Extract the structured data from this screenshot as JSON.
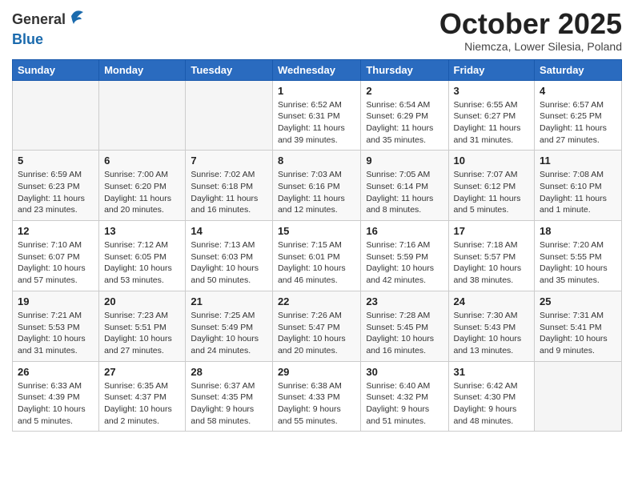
{
  "header": {
    "logo_general": "General",
    "logo_blue": "Blue",
    "month_title": "October 2025",
    "subtitle": "Niemcza, Lower Silesia, Poland"
  },
  "days_of_week": [
    "Sunday",
    "Monday",
    "Tuesday",
    "Wednesday",
    "Thursday",
    "Friday",
    "Saturday"
  ],
  "weeks": [
    [
      {
        "day": "",
        "info": ""
      },
      {
        "day": "",
        "info": ""
      },
      {
        "day": "",
        "info": ""
      },
      {
        "day": "1",
        "info": "Sunrise: 6:52 AM\nSunset: 6:31 PM\nDaylight: 11 hours\nand 39 minutes."
      },
      {
        "day": "2",
        "info": "Sunrise: 6:54 AM\nSunset: 6:29 PM\nDaylight: 11 hours\nand 35 minutes."
      },
      {
        "day": "3",
        "info": "Sunrise: 6:55 AM\nSunset: 6:27 PM\nDaylight: 11 hours\nand 31 minutes."
      },
      {
        "day": "4",
        "info": "Sunrise: 6:57 AM\nSunset: 6:25 PM\nDaylight: 11 hours\nand 27 minutes."
      }
    ],
    [
      {
        "day": "5",
        "info": "Sunrise: 6:59 AM\nSunset: 6:23 PM\nDaylight: 11 hours\nand 23 minutes."
      },
      {
        "day": "6",
        "info": "Sunrise: 7:00 AM\nSunset: 6:20 PM\nDaylight: 11 hours\nand 20 minutes."
      },
      {
        "day": "7",
        "info": "Sunrise: 7:02 AM\nSunset: 6:18 PM\nDaylight: 11 hours\nand 16 minutes."
      },
      {
        "day": "8",
        "info": "Sunrise: 7:03 AM\nSunset: 6:16 PM\nDaylight: 11 hours\nand 12 minutes."
      },
      {
        "day": "9",
        "info": "Sunrise: 7:05 AM\nSunset: 6:14 PM\nDaylight: 11 hours\nand 8 minutes."
      },
      {
        "day": "10",
        "info": "Sunrise: 7:07 AM\nSunset: 6:12 PM\nDaylight: 11 hours\nand 5 minutes."
      },
      {
        "day": "11",
        "info": "Sunrise: 7:08 AM\nSunset: 6:10 PM\nDaylight: 11 hours\nand 1 minute."
      }
    ],
    [
      {
        "day": "12",
        "info": "Sunrise: 7:10 AM\nSunset: 6:07 PM\nDaylight: 10 hours\nand 57 minutes."
      },
      {
        "day": "13",
        "info": "Sunrise: 7:12 AM\nSunset: 6:05 PM\nDaylight: 10 hours\nand 53 minutes."
      },
      {
        "day": "14",
        "info": "Sunrise: 7:13 AM\nSunset: 6:03 PM\nDaylight: 10 hours\nand 50 minutes."
      },
      {
        "day": "15",
        "info": "Sunrise: 7:15 AM\nSunset: 6:01 PM\nDaylight: 10 hours\nand 46 minutes."
      },
      {
        "day": "16",
        "info": "Sunrise: 7:16 AM\nSunset: 5:59 PM\nDaylight: 10 hours\nand 42 minutes."
      },
      {
        "day": "17",
        "info": "Sunrise: 7:18 AM\nSunset: 5:57 PM\nDaylight: 10 hours\nand 38 minutes."
      },
      {
        "day": "18",
        "info": "Sunrise: 7:20 AM\nSunset: 5:55 PM\nDaylight: 10 hours\nand 35 minutes."
      }
    ],
    [
      {
        "day": "19",
        "info": "Sunrise: 7:21 AM\nSunset: 5:53 PM\nDaylight: 10 hours\nand 31 minutes."
      },
      {
        "day": "20",
        "info": "Sunrise: 7:23 AM\nSunset: 5:51 PM\nDaylight: 10 hours\nand 27 minutes."
      },
      {
        "day": "21",
        "info": "Sunrise: 7:25 AM\nSunset: 5:49 PM\nDaylight: 10 hours\nand 24 minutes."
      },
      {
        "day": "22",
        "info": "Sunrise: 7:26 AM\nSunset: 5:47 PM\nDaylight: 10 hours\nand 20 minutes."
      },
      {
        "day": "23",
        "info": "Sunrise: 7:28 AM\nSunset: 5:45 PM\nDaylight: 10 hours\nand 16 minutes."
      },
      {
        "day": "24",
        "info": "Sunrise: 7:30 AM\nSunset: 5:43 PM\nDaylight: 10 hours\nand 13 minutes."
      },
      {
        "day": "25",
        "info": "Sunrise: 7:31 AM\nSunset: 5:41 PM\nDaylight: 10 hours\nand 9 minutes."
      }
    ],
    [
      {
        "day": "26",
        "info": "Sunrise: 6:33 AM\nSunset: 4:39 PM\nDaylight: 10 hours\nand 5 minutes."
      },
      {
        "day": "27",
        "info": "Sunrise: 6:35 AM\nSunset: 4:37 PM\nDaylight: 10 hours\nand 2 minutes."
      },
      {
        "day": "28",
        "info": "Sunrise: 6:37 AM\nSunset: 4:35 PM\nDaylight: 9 hours\nand 58 minutes."
      },
      {
        "day": "29",
        "info": "Sunrise: 6:38 AM\nSunset: 4:33 PM\nDaylight: 9 hours\nand 55 minutes."
      },
      {
        "day": "30",
        "info": "Sunrise: 6:40 AM\nSunset: 4:32 PM\nDaylight: 9 hours\nand 51 minutes."
      },
      {
        "day": "31",
        "info": "Sunrise: 6:42 AM\nSunset: 4:30 PM\nDaylight: 9 hours\nand 48 minutes."
      },
      {
        "day": "",
        "info": ""
      }
    ]
  ]
}
